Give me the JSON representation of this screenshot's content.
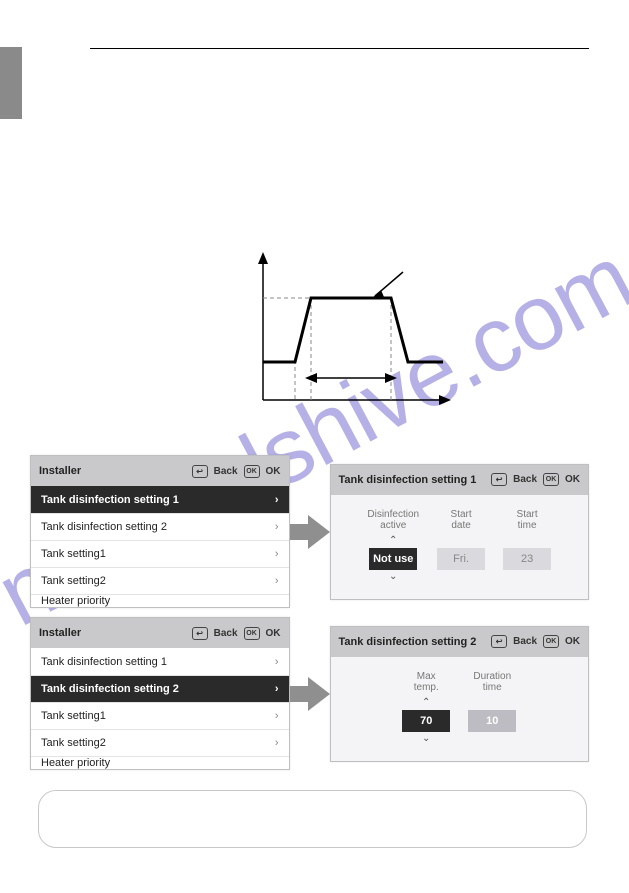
{
  "watermark": "manualshive.com",
  "installer": {
    "title": "Installer",
    "back_label": "Back",
    "ok_label": "OK",
    "back_icon": "↩",
    "ok_icon": "OK",
    "items": [
      {
        "label": "Tank disinfection setting 1"
      },
      {
        "label": "Tank disinfection setting 2"
      },
      {
        "label": "Tank setting1"
      },
      {
        "label": "Tank setting2"
      },
      {
        "label": "Heater priority"
      }
    ]
  },
  "detail1": {
    "title": "Tank disinfection setting 1",
    "back_label": "Back",
    "ok_label": "OK",
    "fields": [
      {
        "label_l1": "Disinfection",
        "label_l2": "active",
        "value": "Not use",
        "style": "dark",
        "spinner": true
      },
      {
        "label_l1": "Start",
        "label_l2": "date",
        "value": "Fri.",
        "style": "light",
        "spinner": false
      },
      {
        "label_l1": "Start",
        "label_l2": "time",
        "value": "23",
        "style": "light",
        "spinner": false
      }
    ]
  },
  "detail2": {
    "title": "Tank disinfection setting 2",
    "back_label": "Back",
    "ok_label": "OK",
    "fields": [
      {
        "label_l1": "Max",
        "label_l2": "temp.",
        "value": "70",
        "style": "dark",
        "spinner": true
      },
      {
        "label_l1": "Duration",
        "label_l2": "time",
        "value": "10",
        "style": "grey",
        "spinner": false
      }
    ]
  }
}
